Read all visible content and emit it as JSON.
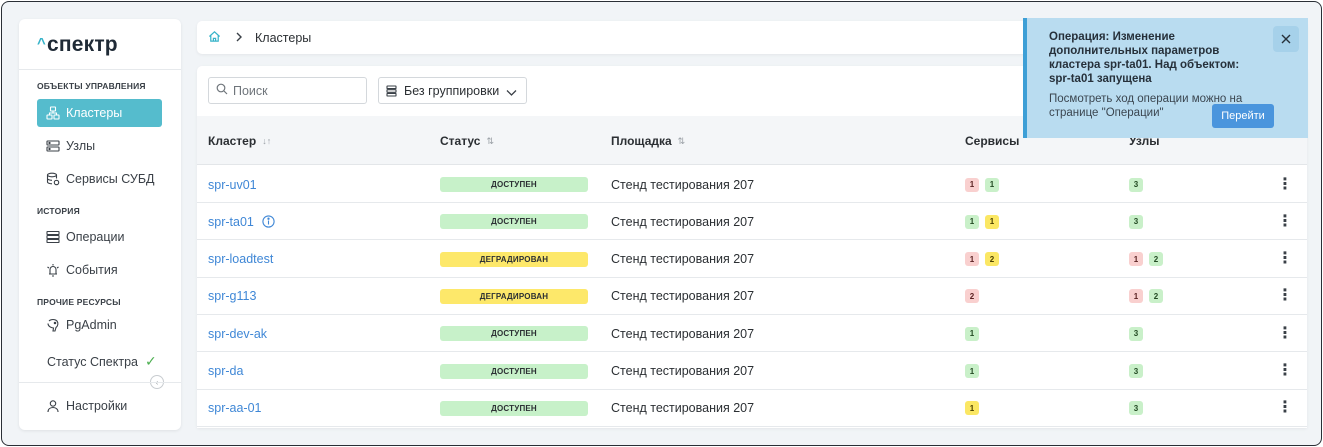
{
  "app": {
    "logo_text": "спектр",
    "logo_mark": "^"
  },
  "sidebar": {
    "sections": [
      {
        "title": "ОБЪЕКТЫ УПРАВЛЕНИЯ"
      },
      {
        "title": "ИСТОРИЯ"
      },
      {
        "title": "ПРОЧИЕ РЕСУРСЫ"
      }
    ],
    "items": [
      {
        "label": "Кластеры",
        "icon": "cluster-icon",
        "active": true
      },
      {
        "label": "Узлы",
        "icon": "server-icon"
      },
      {
        "label": "Сервисы СУБД",
        "icon": "database-service-icon"
      },
      {
        "label": "Операции",
        "icon": "operations-icon"
      },
      {
        "label": "События",
        "icon": "events-icon"
      },
      {
        "label": "PgAdmin",
        "icon": "pgadmin-icon"
      }
    ],
    "status_label": "Статус Спектра",
    "settings_label": "Настройки"
  },
  "breadcrumb": {
    "current": "Кластеры"
  },
  "toolbar": {
    "search_placeholder": "Поиск",
    "grouping_value": "Без группировки"
  },
  "table": {
    "columns": [
      "Кластер",
      "Статус",
      "Площадка",
      "Сервисы",
      "Узлы"
    ],
    "rows": [
      {
        "name": "spr-uv01",
        "status": "ДОСТУПЕН",
        "status_kind": "ok",
        "site": "Стенд тестирования 207",
        "services": [
          {
            "v": "1",
            "c": "red"
          },
          {
            "v": "1",
            "c": "green"
          }
        ],
        "nodes": [
          {
            "v": "3",
            "c": "green"
          }
        ]
      },
      {
        "name": "spr-ta01",
        "info": true,
        "status": "ДОСТУПЕН",
        "status_kind": "ok",
        "site": "Стенд тестирования 207",
        "services": [
          {
            "v": "1",
            "c": "green"
          },
          {
            "v": "1",
            "c": "yellow"
          }
        ],
        "nodes": [
          {
            "v": "3",
            "c": "green"
          }
        ]
      },
      {
        "name": "spr-loadtest",
        "status": "ДЕГРАДИРОВАН",
        "status_kind": "deg",
        "site": "Стенд тестирования 207",
        "services": [
          {
            "v": "1",
            "c": "red"
          },
          {
            "v": "2",
            "c": "yellow"
          }
        ],
        "nodes": [
          {
            "v": "1",
            "c": "red"
          },
          {
            "v": "2",
            "c": "green"
          }
        ]
      },
      {
        "name": "spr-g113",
        "status": "ДЕГРАДИРОВАН",
        "status_kind": "deg",
        "site": "Стенд тестирования 207",
        "services": [
          {
            "v": "2",
            "c": "red"
          }
        ],
        "nodes": [
          {
            "v": "1",
            "c": "red"
          },
          {
            "v": "2",
            "c": "green"
          }
        ]
      },
      {
        "name": "spr-dev-ak",
        "status": "ДОСТУПЕН",
        "status_kind": "ok",
        "site": "Стенд тестирования 207",
        "services": [
          {
            "v": "1",
            "c": "green"
          }
        ],
        "nodes": [
          {
            "v": "3",
            "c": "green"
          }
        ]
      },
      {
        "name": "spr-da",
        "status": "ДОСТУПЕН",
        "status_kind": "ok",
        "site": "Стенд тестирования 207",
        "services": [
          {
            "v": "1",
            "c": "green"
          }
        ],
        "nodes": [
          {
            "v": "3",
            "c": "green"
          }
        ]
      },
      {
        "name": "spr-aa-01",
        "status": "ДОСТУПЕН",
        "status_kind": "ok",
        "site": "Стенд тестирования 207",
        "services": [
          {
            "v": "1",
            "c": "yellow"
          }
        ],
        "nodes": [
          {
            "v": "3",
            "c": "green"
          }
        ]
      }
    ]
  },
  "toast": {
    "title": "Операция: Изменение дополнительных параметров кластера spr-ta01. Над объектом: spr-ta01 запущена",
    "text": "Посмотреть ход операции можно на странице \"Операции\"",
    "button": "Перейти"
  },
  "colors": {
    "accent": "#55bccd",
    "link": "#3f87d6",
    "ok": "#c7f1c9",
    "degraded": "#fde86a",
    "toast_bg": "#b9dcf0"
  }
}
